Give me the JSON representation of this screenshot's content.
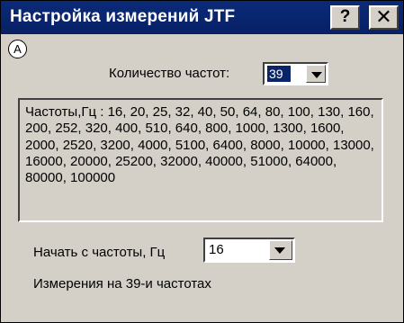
{
  "window": {
    "title": "Настройка измерений JTF",
    "help_label": "?",
    "close_label": "✕",
    "marker": "A"
  },
  "count": {
    "label": "Количество частот:",
    "value": "39"
  },
  "frequencies": {
    "text": "Частоты,Гц : 16, 20, 25, 32, 40, 50, 64, 80, 100, 130, 160, 200, 252, 320, 400, 510, 640, 800, 1000, 1300, 1600, 2000, 2520, 3200, 4000, 5100, 6400, 8000, 10000, 13000, 16000, 20000, 25200, 32000, 40000, 51000, 64000, 80000, 100000"
  },
  "start": {
    "label": "Начать с частоты, Гц",
    "value": "16"
  },
  "status": {
    "text": "Измерения на 39-и частотах"
  },
  "colors": {
    "titlebar": "#0a246a",
    "dialog_bg": "#d4d0c8",
    "selection": "#0a246a"
  }
}
